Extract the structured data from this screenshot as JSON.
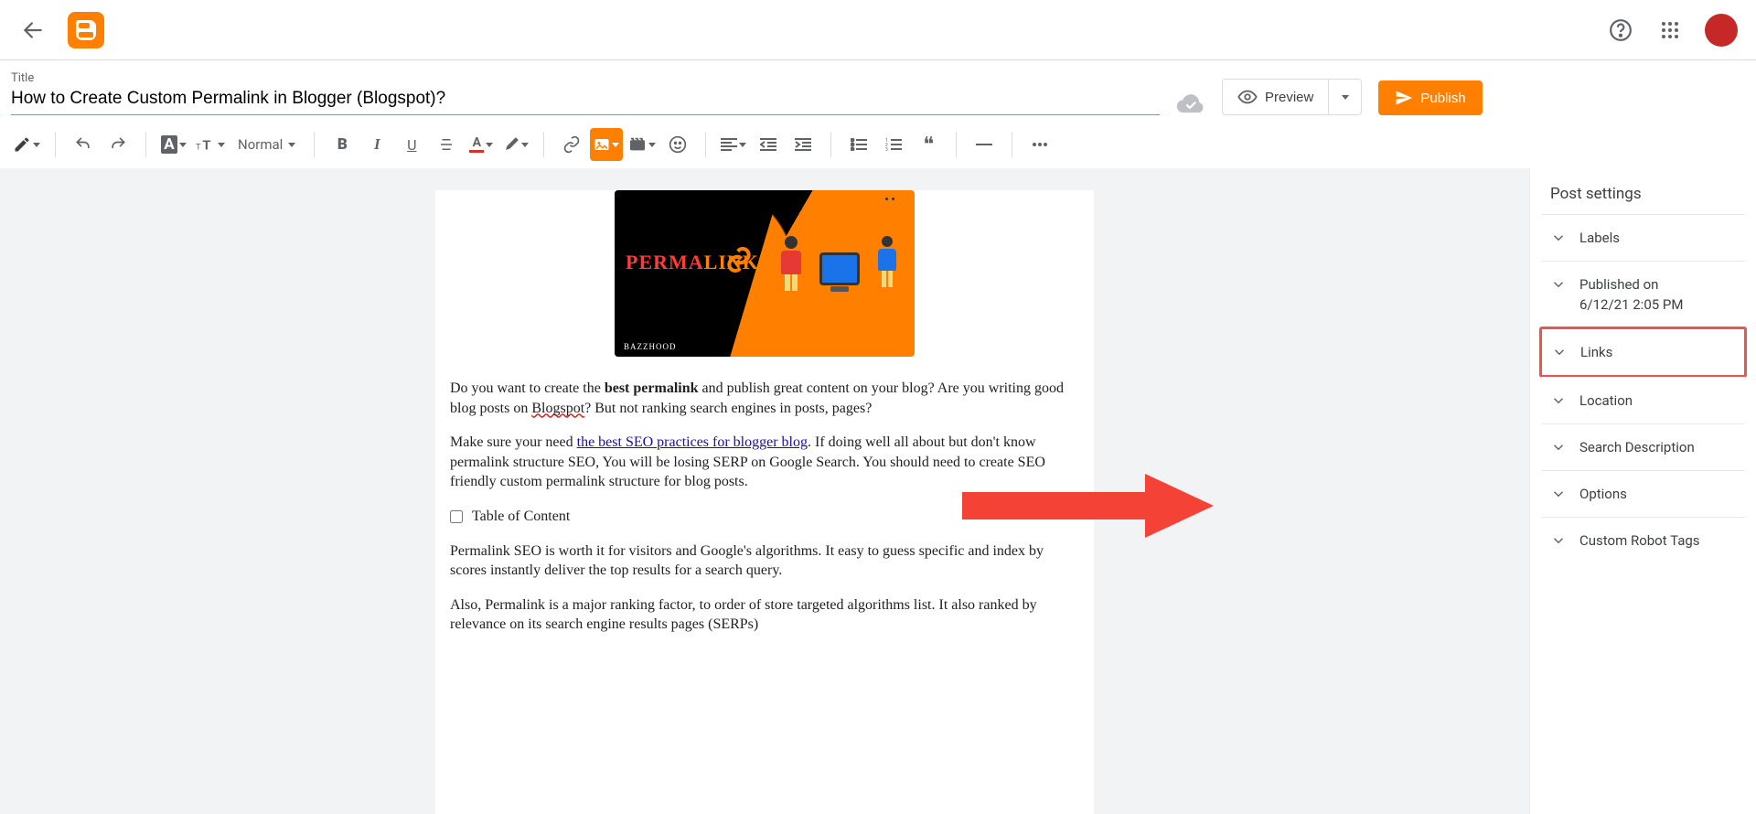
{
  "appbar": {},
  "title": {
    "label": "Title",
    "value": "How to Create Custom Permalink in Blogger (Blogspot)?"
  },
  "actions": {
    "preview": "Preview",
    "publish": "Publish"
  },
  "toolbar": {
    "paragraph_style": "Normal"
  },
  "editor": {
    "hero_brand": "BAZZHOOD",
    "hero_text1": "PERMA",
    "hero_text2": "LINK",
    "para1_a": "Do you want to create the ",
    "para1_bold": "best permalink",
    "para1_b": " and publish great content on your blog? Are you writing good blog posts on ",
    "para1_blogspot": "Blogspot",
    "para1_c": "? But not ranking search engines in posts, pages?",
    "para2_a": "Make sure your need ",
    "para2_link": "the best SEO practices for blogger blog",
    "para2_b": ". If doing well all about but don't know permalink structure SEO, You will be losing SERP on Google Search. You should need to create SEO friendly custom permalink structure for blog posts.",
    "toc_label": "Table of Content",
    "para3": "Permalink SEO is worth it for visitors and Google's algorithms. It easy to guess specific and index by scores instantly deliver the top results for a search query.",
    "para4": "Also, Permalink is a major ranking factor, to order of store targeted algorithms list. It also ranked by relevance on its search engine results pages (SERPs)"
  },
  "settings": {
    "heading": "Post settings",
    "labels": "Labels",
    "published_heading": "Published on",
    "published_value": "6/12/21 2:05 PM",
    "links": "Links",
    "location": "Location",
    "search_description": "Search Description",
    "options": "Options",
    "custom_robot_tags": "Custom Robot Tags"
  }
}
